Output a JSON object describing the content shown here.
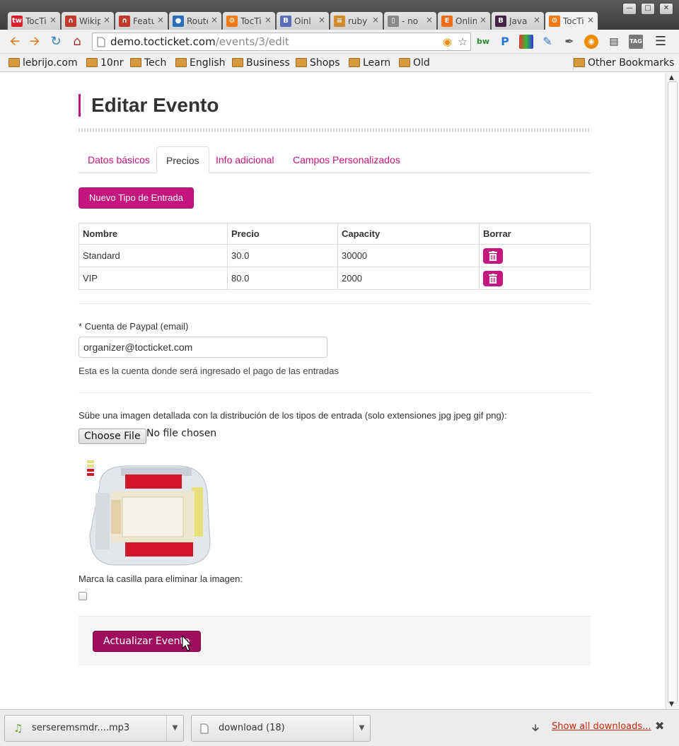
{
  "browser": {
    "tabs": [
      {
        "title": "TocTicket",
        "icon": "tw-icon",
        "color": "#d6202b",
        "active": false
      },
      {
        "title": "Wikipedia",
        "icon": "horseshoe-icon",
        "color": "#c0392b",
        "active": false
      },
      {
        "title": "Features",
        "icon": "horseshoe-icon",
        "color": "#c0392b",
        "active": false
      },
      {
        "title": "Routes",
        "icon": "globe-icon",
        "color": "#2a6ebb",
        "active": false
      },
      {
        "title": "TocTicket",
        "icon": "gear-icon",
        "color": "#ef7a1a",
        "active": false
      },
      {
        "title": "Oinl",
        "icon": "b-icon",
        "color": "#5a6dbb",
        "active": false
      },
      {
        "title": "ruby",
        "icon": "stack-icon",
        "color": "#d38a2f",
        "active": false
      },
      {
        "title": "- no",
        "icon": "page-icon",
        "color": "#888888",
        "active": false
      },
      {
        "title": "Online",
        "icon": "e-icon",
        "color": "#ef6c1a",
        "active": false
      },
      {
        "title": "Java",
        "icon": "b-icon",
        "color": "#442244",
        "active": false
      },
      {
        "title": "TocTicket",
        "icon": "gear-icon",
        "color": "#ef7a1a",
        "active": true
      }
    ],
    "url_host": "demo.tocticket.com",
    "url_path": "/events/3/edit",
    "bookmarks": [
      "lebrijo.com",
      "10nr",
      "Tech",
      "English",
      "Business",
      "Shops",
      "Learn",
      "Old"
    ],
    "other_bookmarks": "Other Bookmarks"
  },
  "page": {
    "title": "Editar Evento",
    "tabs": [
      "Datos básicos",
      "Precios",
      "Info adicional",
      "Campos Personalizados"
    ],
    "active_tab": "Precios",
    "new_ticket_button": "Nuevo Tipo de Entrada",
    "table": {
      "headers": [
        "Nombre",
        "Precio",
        "Capacity",
        "Borrar"
      ],
      "rows": [
        {
          "name": "Standard",
          "price": "30.0",
          "capacity": "30000"
        },
        {
          "name": "VIP",
          "price": "80.0",
          "capacity": "2000"
        }
      ]
    },
    "paypal": {
      "required_mark": "*",
      "label": "Cuenta de Paypal (email)",
      "value": "organizer@tocticket.com",
      "help": "Esta es la cuenta donde será ingresado el pago de las entradas"
    },
    "upload": {
      "label": "Sübe una imagen detallada con la distribución de los tipos de entrada (solo extensiones jpg jpeg gif png):",
      "button": "Choose File",
      "status": "No file chosen"
    },
    "remove_image_label": "Marca la casilla para eliminar la imagen:",
    "remove_image_checked": false,
    "submit": "Actualizar Evento",
    "accent_color": "#c5157f"
  },
  "downloads": {
    "items": [
      {
        "name": "serseremsmdr....mp3",
        "icon": "music-file-icon"
      },
      {
        "name": "download (18)",
        "icon": "file-icon"
      }
    ],
    "show_all": "Show all downloads..."
  }
}
